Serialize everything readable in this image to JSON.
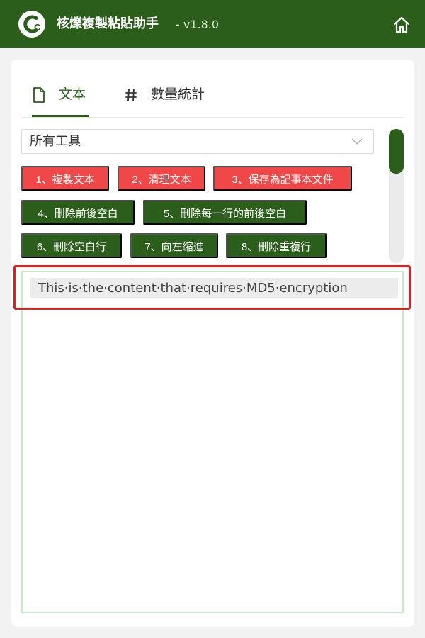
{
  "header": {
    "title": "核爍複製粘貼助手",
    "version": "- v1.8.0",
    "logo_icon": "cc-logo-icon",
    "home_icon": "home-icon",
    "background_color": "#2b5e1a"
  },
  "tabs": [
    {
      "label": "文本",
      "icon": "document-icon",
      "active": true
    },
    {
      "label": "數量統計",
      "icon": "hash-icon",
      "active": false
    }
  ],
  "tool_select": {
    "value": "所有工具"
  },
  "tools": [
    {
      "label": "1、複製文本",
      "color": "#f04848"
    },
    {
      "label": "2、清理文本",
      "color": "#f04848"
    },
    {
      "label": "3、保存為記事本文件",
      "color": "#f04848"
    },
    {
      "label": "4、刪除前後空白",
      "color": "#2b5e1a"
    },
    {
      "label": "5、刪除每一行的前後空白",
      "color": "#2b5e1a"
    },
    {
      "label": "6、刪除空白行",
      "color": "#2b5e1a"
    },
    {
      "label": "7、向左縮進",
      "color": "#2b5e1a"
    },
    {
      "label": "8、刪除重複行",
      "color": "#2b5e1a"
    }
  ],
  "editor": {
    "content": "This·is·the·content·that·requires·MD5·encryption",
    "highlight_color": "#e02020"
  }
}
